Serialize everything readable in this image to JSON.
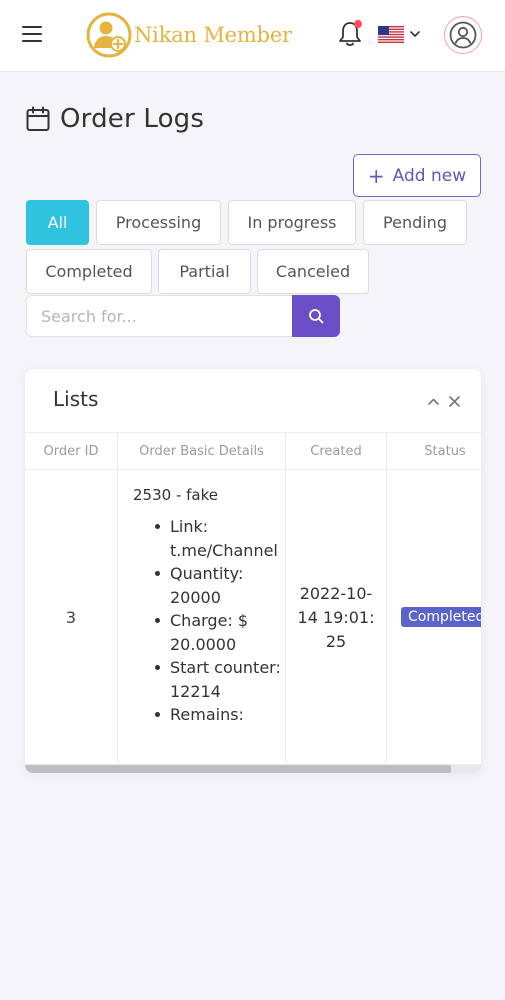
{
  "header": {
    "brand_name": "Nikan Member",
    "menu_icon": "hamburger-menu-icon",
    "notification_icon": "bell-icon",
    "language_icon": "us-flag-icon",
    "profile_icon": "user-circle-icon",
    "accent_color": "#e6b33f"
  },
  "page": {
    "title": "Order Logs",
    "title_icon": "calendar-icon",
    "add_new_label": "Add new"
  },
  "filters": [
    {
      "label": "All",
      "active": true
    },
    {
      "label": "Processing",
      "active": false
    },
    {
      "label": "In progress",
      "active": false
    },
    {
      "label": "Pending",
      "active": false
    },
    {
      "label": "Completed",
      "active": false
    },
    {
      "label": "Partial",
      "active": false
    },
    {
      "label": "Canceled",
      "active": false
    }
  ],
  "search": {
    "placeholder": "Search for...",
    "value": ""
  },
  "card": {
    "title": "Lists",
    "columns": [
      "Order ID",
      "Order Basic Details",
      "Created",
      "Status"
    ],
    "rows": [
      {
        "order_id": "3",
        "detail_title": "2530 - fake",
        "details": [
          "Link: t.me/Channel",
          "Quantity: 20000",
          "Charge: $ 20.0000",
          "Start counter: 12214",
          "Remains:"
        ],
        "created": "2022-10-14 19:01:25",
        "status": "Completed"
      }
    ]
  },
  "colors": {
    "active_filter": "#2fc3e0",
    "search_button": "#6a4ec5",
    "status_completed": "#5a63c9",
    "add_new_border": "#7367c8"
  }
}
